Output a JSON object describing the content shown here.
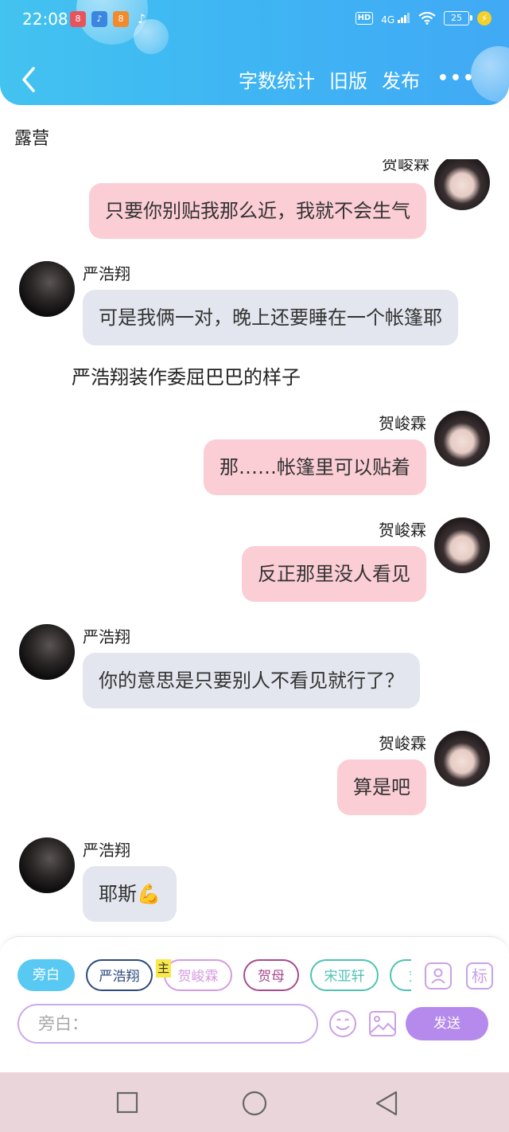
{
  "status_bar": {
    "time": "22:08",
    "network": "4G",
    "hd": "HD",
    "battery": "25"
  },
  "toolbar": {
    "word_count": "字数统计",
    "old_version": "旧版",
    "publish": "发布",
    "more": "•••"
  },
  "chapter": {
    "title": "露营"
  },
  "chat": {
    "messages": [
      {
        "speaker": "贺峻霖",
        "text": "只要你别贴我那么近，我就不会生气"
      },
      {
        "speaker": "严浩翔",
        "text": "可是我俩一对，晚上还要睡在一个帐篷耶"
      },
      {
        "narration": "严浩翔装作委屈巴巴的样子"
      },
      {
        "speaker": "贺峻霖",
        "text": "那……帐篷里可以贴着"
      },
      {
        "speaker": "贺峻霖",
        "text": "反正那里没人看见"
      },
      {
        "speaker": "严浩翔",
        "text": "你的意思是只要别人不看见就行了？"
      },
      {
        "speaker": "贺峻霖",
        "text": "算是吧"
      },
      {
        "speaker": "严浩翔",
        "text": "耶斯💪"
      }
    ]
  },
  "composer": {
    "roles": [
      {
        "label": "旁白"
      },
      {
        "label": "严浩翔",
        "color": "#2c4a7a"
      },
      {
        "label": "贺峻霖",
        "color": "#d59be0"
      },
      {
        "label": "贺母",
        "color": "#a84a8e"
      },
      {
        "label": "宋亚轩",
        "color": "#4fc2b4"
      },
      {
        "label": "刘",
        "color": "#4fc2b4"
      }
    ],
    "main_badge": "主",
    "tag_button": "标",
    "input_placeholder": "旁白：",
    "send_label": "发送"
  },
  "colors": {
    "header": "#3fb6f3",
    "bubble_self": "#fbcdd5",
    "bubble_other": "#e3e6ee",
    "accent_purple": "#b58aec",
    "nav_bar": "#ead5da"
  }
}
